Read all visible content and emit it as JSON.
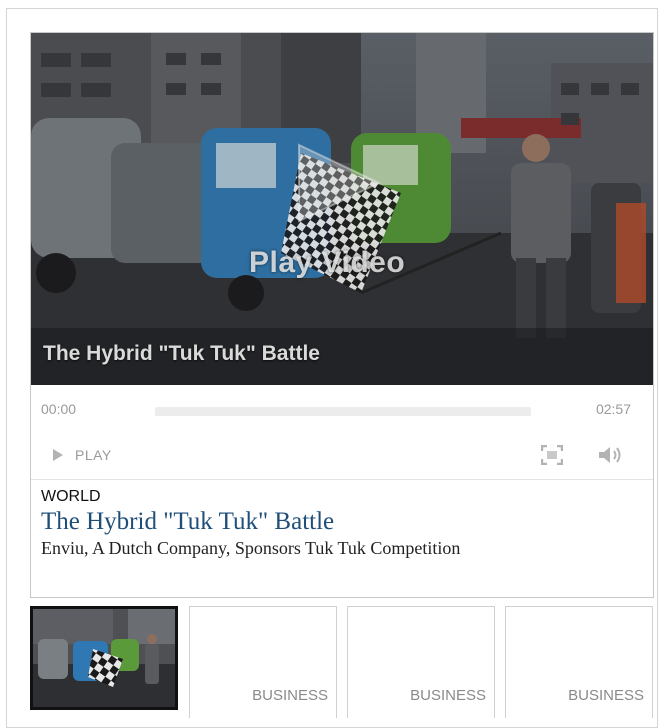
{
  "player": {
    "overlay_text": "Play Video",
    "caption": "The Hybrid \"Tuk Tuk\" Battle",
    "time_current": "00:00",
    "time_total": "02:57",
    "play_label": "PLAY",
    "progress": 0
  },
  "article": {
    "category": "WORLD",
    "title": "The Hybrid \"Tuk Tuk\" Battle",
    "subtitle": "Enviu, A Dutch Company, Sponsors Tuk Tuk Competition"
  },
  "thumbnails": [
    {
      "label": "",
      "active": true
    },
    {
      "label": "BUSINESS",
      "active": false
    },
    {
      "label": "BUSINESS",
      "active": false
    },
    {
      "label": "BUSINESS",
      "active": false
    }
  ],
  "icons": {
    "play": "play-icon",
    "fullscreen": "fullscreen-icon",
    "volume": "volume-icon"
  },
  "colors": {
    "headline": "#1f4e79",
    "control_gray": "#9a9a9a"
  }
}
